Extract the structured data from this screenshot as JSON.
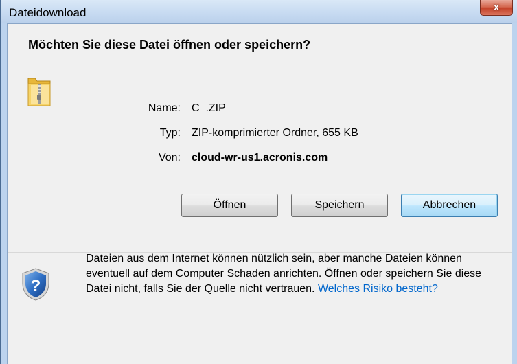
{
  "window": {
    "title": "Dateidownload",
    "close_label": "x"
  },
  "dialog": {
    "question": "Möchten Sie diese Datei öffnen oder speichern?",
    "file": {
      "icon": "zip-folder-icon",
      "name_label": "Name:",
      "name_value": "C_.ZIP",
      "type_label": "Typ:",
      "type_value": "ZIP-komprimierter Ordner, 655 KB",
      "from_label": "Von:",
      "from_value": "cloud-wr-us1.acronis.com"
    },
    "buttons": {
      "open": "Öffnen",
      "save": "Speichern",
      "cancel": "Abbrechen"
    },
    "info": {
      "icon": "shield-question-icon",
      "text": "Dateien aus dem Internet können nützlich sein, aber manche Dateien können eventuell auf dem Computer Schaden anrichten. Öffnen oder speichern Sie diese Datei nicht, falls Sie der Quelle nicht vertrauen.",
      "link": "Welches Risiko besteht?"
    }
  },
  "colors": {
    "titlebar": "#c9dcf2",
    "close": "#c4432a",
    "client": "#f0f0f0",
    "link": "#0066cc"
  }
}
